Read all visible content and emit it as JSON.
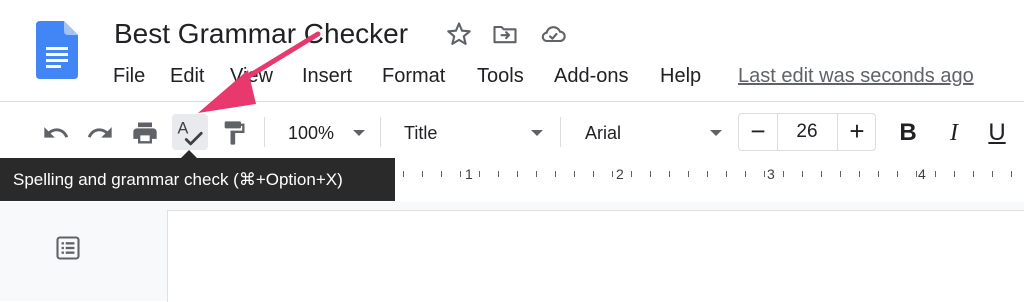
{
  "document": {
    "title": "Best Grammar Checker"
  },
  "menu": {
    "items": [
      "File",
      "Edit",
      "View",
      "Insert",
      "Format",
      "Tools",
      "Add-ons",
      "Help"
    ],
    "last_edit": "Last edit was seconds ago"
  },
  "toolbar": {
    "zoom": "100%",
    "style": "Title",
    "font": "Arial",
    "font_size": "26",
    "minus": "−",
    "plus": "+",
    "bold": "B",
    "italic": "I",
    "underline": "U"
  },
  "tooltip": {
    "text": "Spelling and grammar check (⌘+Option+X)"
  },
  "ruler": {
    "numbers": [
      "1",
      "2",
      "3",
      "4"
    ]
  },
  "colors": {
    "accent": "#4285f4",
    "annotation_arrow": "#e8386d",
    "tooltip_bg": "#2a2a2a"
  },
  "icons": {
    "logo": "google-docs-logo",
    "star": "star-icon",
    "move": "move-to-folder-icon",
    "cloud": "cloud-saved-icon",
    "undo": "undo-icon",
    "redo": "redo-icon",
    "print": "print-icon",
    "spellcheck": "spellcheck-icon",
    "paint_format": "paint-format-icon",
    "outline": "document-outline-icon"
  }
}
